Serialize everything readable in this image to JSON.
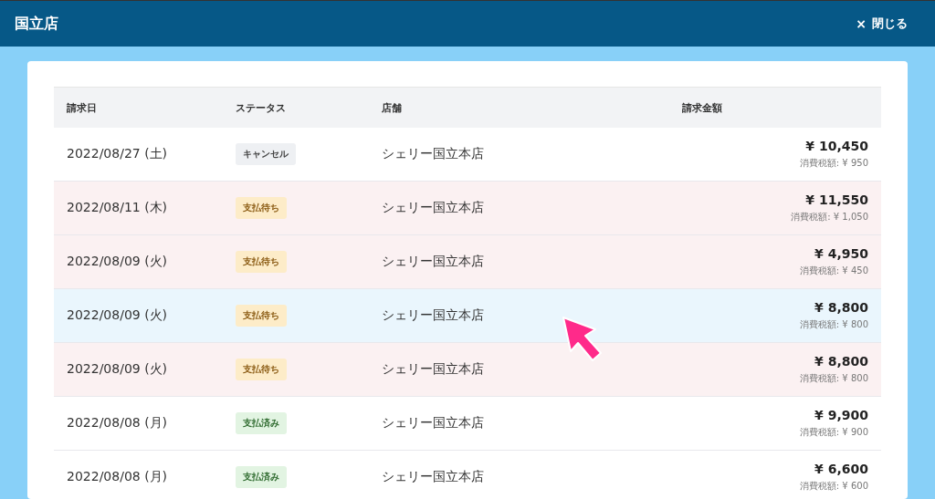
{
  "header": {
    "title": "国立店",
    "close_label": "閉じる",
    "close_icon": "×"
  },
  "table": {
    "columns": [
      "請求日",
      "ステータス",
      "店舗",
      "請求金額"
    ],
    "rows": [
      {
        "date": "2022/08/27 (土)",
        "status": {
          "label": "キャンセル",
          "kind": "cancelled"
        },
        "store": "シェリー国立本店",
        "amount": "¥ 10,450",
        "tax": "消費税額: ¥ 950",
        "hovered": false
      },
      {
        "date": "2022/08/11 (木)",
        "status": {
          "label": "支払待ち",
          "kind": "pending"
        },
        "store": "シェリー国立本店",
        "amount": "¥ 11,550",
        "tax": "消費税額: ¥ 1,050",
        "hovered": false
      },
      {
        "date": "2022/08/09 (火)",
        "status": {
          "label": "支払待ち",
          "kind": "pending"
        },
        "store": "シェリー国立本店",
        "amount": "¥ 4,950",
        "tax": "消費税額: ¥ 450",
        "hovered": false
      },
      {
        "date": "2022/08/09 (火)",
        "status": {
          "label": "支払待ち",
          "kind": "pending"
        },
        "store": "シェリー国立本店",
        "amount": "¥ 8,800",
        "tax": "消費税額: ¥ 800",
        "hovered": true
      },
      {
        "date": "2022/08/09 (火)",
        "status": {
          "label": "支払待ち",
          "kind": "pending"
        },
        "store": "シェリー国立本店",
        "amount": "¥ 8,800",
        "tax": "消費税額: ¥ 800",
        "hovered": false
      },
      {
        "date": "2022/08/08 (月)",
        "status": {
          "label": "支払済み",
          "kind": "paid"
        },
        "store": "シェリー国立本店",
        "amount": "¥ 9,900",
        "tax": "消費税額: ¥ 900",
        "hovered": false
      },
      {
        "date": "2022/08/08 (月)",
        "status": {
          "label": "支払済み",
          "kind": "paid"
        },
        "store": "シェリー国立本店",
        "amount": "¥ 6,600",
        "tax": "消費税額: ¥ 600",
        "hovered": false
      }
    ]
  }
}
